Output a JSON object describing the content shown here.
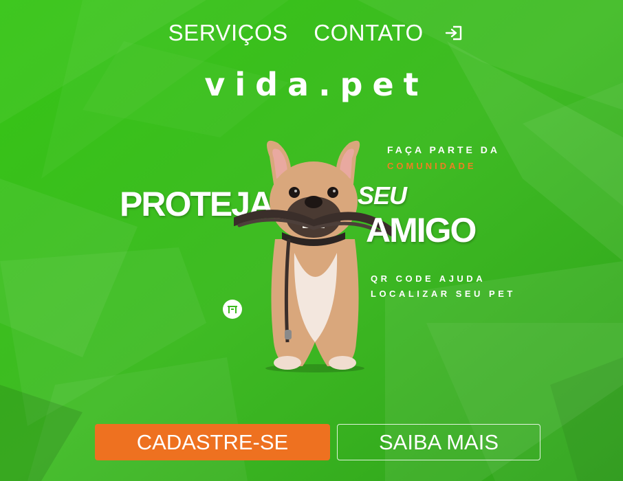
{
  "nav": {
    "items": [
      {
        "label": "SERVIÇOS"
      },
      {
        "label": "CONTATO"
      }
    ],
    "login_icon": "login-icon"
  },
  "brand": {
    "name": "vida.pet"
  },
  "hero": {
    "tagline_top": "FAÇA PARTE DA",
    "tagline_highlight": "COMUNIDADE",
    "headline_word_1": "PROTEJA",
    "headline_word_2": "SEU",
    "headline_word_3": "AMIGO",
    "qr_line_1": "QR CODE AJUDA",
    "qr_line_2": "LOCALIZAR SEU PET",
    "logo_icon": "brand-mark-icon",
    "image": "french-bulldog-with-leash"
  },
  "actions": {
    "primary_label": "CADASTRE-SE",
    "secondary_label": "SAIBA MAIS"
  },
  "colors": {
    "background": "#3cba1e",
    "accent": "#ee7120",
    "text": "#ffffff"
  }
}
